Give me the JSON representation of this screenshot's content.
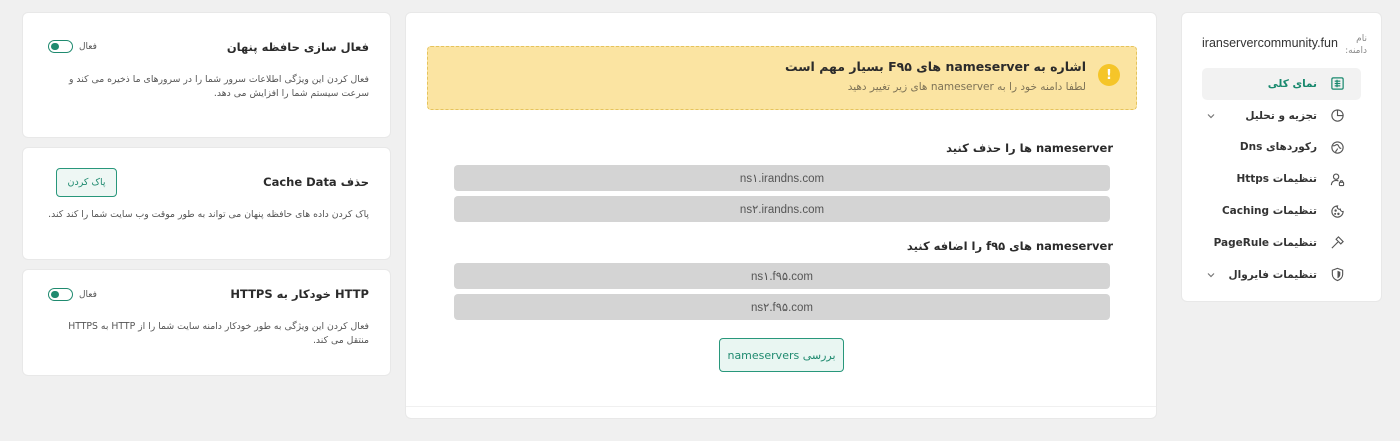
{
  "sidebar": {
    "domain_label": "نام دامنه:",
    "domain_value": "iranservercommunity.fun",
    "items": [
      {
        "label": "نمای کلی",
        "icon": "overview-icon",
        "active": true
      },
      {
        "label": "تجزیه و تحلیل",
        "icon": "chart-icon",
        "has_children": true
      },
      {
        "label": "رکوردهای Dns",
        "icon": "globe-icon"
      },
      {
        "label": "تنظیمات Https",
        "icon": "user-lock-icon"
      },
      {
        "label": "تنظیمات Caching",
        "icon": "cookie-icon"
      },
      {
        "label": "تنظیمات PageRule",
        "icon": "hammer-icon"
      },
      {
        "label": "تنظیمات فایروال",
        "icon": "shield-icon",
        "has_children": true
      }
    ]
  },
  "main": {
    "alert_title": "اشاره به nameserver های F۹۵ بسیار مهم است",
    "alert_subtitle": "لطفا دامنه خود را به nameserver های زیر تغییر دهید",
    "remove_title": "nameserver ها را حذف کنید",
    "remove_list": [
      "ns۱.irandns.com",
      "ns۲.irandns.com"
    ],
    "add_title": "nameserver های f۹۵ را اضافه کنید",
    "add_list": [
      "ns۱.f۹۵.com",
      "ns۲.f۹۵.com"
    ],
    "check_button": "بررسی nameservers"
  },
  "settings": {
    "cache": {
      "title": "فعال سازی حافظه پنهان",
      "toggle_label": "فعال",
      "enabled": true,
      "description": "فعال کردن این ویژگی اطلاعات سرور شما را در سرورهای ما ذخیره می کند و سرعت سیستم شما را افزایش می دهد."
    },
    "clear": {
      "title": "حذف Cache Data",
      "button": "پاک کردن",
      "description": "پاک کردن داده های حافظه پنهان می تواند به طور موقت وب سایت شما را کند کند."
    },
    "https": {
      "title": "HTTP خودکار به HTTPS",
      "toggle_label": "فعال",
      "enabled": true,
      "description": "فعال کردن این ویژگی به طور خودکار دامنه سایت شما را از HTTP به HTTPS منتقل می کند."
    }
  },
  "colors": {
    "accent": "#1f8a6f",
    "alert_bg": "#fbe4a2",
    "alert_icon": "#f5c529"
  }
}
